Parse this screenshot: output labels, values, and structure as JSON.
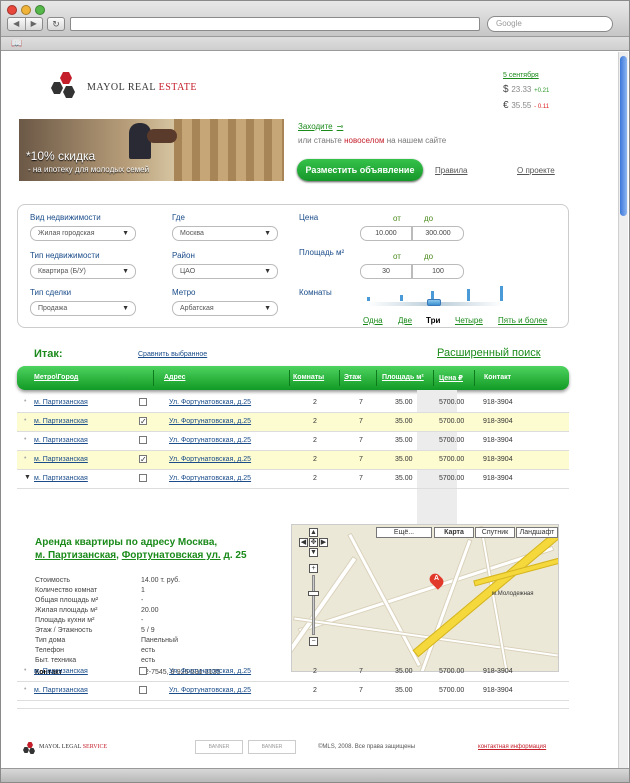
{
  "browser": {
    "search_placeholder": "Google"
  },
  "header": {
    "brand_mayol": "MAYOL",
    "brand_real": "REAL",
    "brand_estate": "ESTATE",
    "date": "5 сентября",
    "usd": {
      "symbol": "$",
      "value": "23.33",
      "change": "+0.21"
    },
    "eur": {
      "symbol": "€",
      "value": "35.55",
      "change": "- 0.11"
    },
    "login": "Заходите",
    "login_arrow": "⊸",
    "register_prefix": "или станьте",
    "register_link": "новоселом",
    "register_suffix": "на нашем сайте",
    "post_button": "Разместить объявление",
    "rules": "Правила",
    "about": "О проекте"
  },
  "banner": {
    "big": "*10% скидка",
    "small": "- на ипотеку для молодых семей"
  },
  "filters": {
    "property_label": "Вид недвижимости",
    "property_value": "Жилая городская",
    "where_label": "Где",
    "where_value": "Москва",
    "ptype_label": "Тип недвижимости",
    "ptype_value": "Квартира (Б/У)",
    "district_label": "Район",
    "district_value": "ЦАО",
    "deal_label": "Тип сделки",
    "deal_value": "Продажа",
    "metro_label": "Метро",
    "metro_value": "Арбатская",
    "price_label": "Цена",
    "from": "от",
    "to": "до",
    "price_from": "10.000",
    "price_to": "300.000",
    "area_label": "Площадь м²",
    "area_from": "30",
    "area_to": "100",
    "rooms_label": "Комнаты",
    "rooms": [
      "Одна",
      "Две",
      "Три",
      "Четыре",
      "Пять и более"
    ],
    "rooms_selected": 2
  },
  "results": {
    "total_label": "Итак:",
    "compare": "Сравнить выбранное",
    "advanced": "Расширенный поиск",
    "columns": [
      "Метро\\Город",
      "Адрес",
      "Комнаты",
      "Этаж",
      "Площадь м²",
      "Цена ₽",
      "Контакт"
    ],
    "rows": [
      {
        "metro": "м. Партизанская",
        "checked": false,
        "address": "Ул. Фортунатовская, д.25",
        "rooms": "2",
        "floor": "7",
        "area": "35.00",
        "price": "5700.00",
        "contact": "918-3904",
        "hl": false
      },
      {
        "metro": "м. Партизанская",
        "checked": true,
        "address": "Ул. Фортунатовская, д.25",
        "rooms": "2",
        "floor": "7",
        "area": "35.00",
        "price": "5700.00",
        "contact": "918-3904",
        "hl": true
      },
      {
        "metro": "м. Партизанская",
        "checked": false,
        "address": "Ул. Фортунатовская, д.25",
        "rooms": "2",
        "floor": "7",
        "area": "35.00",
        "price": "5700.00",
        "contact": "918-3904",
        "hl": false
      },
      {
        "metro": "м. Партизанская",
        "checked": true,
        "address": "Ул. Фортунатовская, д.25",
        "rooms": "2",
        "floor": "7",
        "area": "35.00",
        "price": "5700.00",
        "contact": "918-3904",
        "hl": true
      },
      {
        "metro": "м. Партизанская",
        "checked": false,
        "address": "Ул. Фортунатовская, д.25",
        "rooms": "2",
        "floor": "7",
        "area": "35.00",
        "price": "5700.00",
        "contact": "918-3904",
        "hl": false
      }
    ],
    "rows_after": [
      {
        "metro": "м. Партизанская",
        "checked": false,
        "address": "Ул. Фортунатовская, д.25",
        "rooms": "2",
        "floor": "7",
        "area": "35.00",
        "price": "5700.00",
        "contact": "918-3904"
      },
      {
        "metro": "м. Партизанская",
        "checked": false,
        "address": "Ул. Фортунатовская, д.25",
        "rooms": "2",
        "floor": "7",
        "area": "35.00",
        "price": "5700.00",
        "contact": "918-3904"
      }
    ]
  },
  "detail": {
    "title": "Аренда квартиры по адресу Москва,",
    "metro": "м. Партизанская",
    "comma": ",",
    "street": "Фортунатовская ул.",
    "house": "д. 25",
    "fields": [
      {
        "k": "Стоимость",
        "v": "14.00 т. руб."
      },
      {
        "k": "Количество комнат",
        "v": "1"
      },
      {
        "k": "Общая площадь м²",
        "v": "-"
      },
      {
        "k": "Жилая площадь м²",
        "v": "20.00"
      },
      {
        "k": "Площадь кухни м²",
        "v": "-"
      },
      {
        "k": "Этаж / Этажность",
        "v": "5 / 9"
      },
      {
        "k": "Тип дома",
        "v": "Панельный"
      },
      {
        "k": "Телефон",
        "v": "есть"
      },
      {
        "k": "Быт. техника",
        "v": "есть"
      }
    ],
    "contact_label": "Контакт",
    "contact_value": "92-7545, 8-926-531-3135"
  },
  "map": {
    "more": "Ещё...",
    "map": "Карта",
    "sat": "Спутник",
    "land": "Ландшафт",
    "marker": "A",
    "station": "м.Молодежная",
    "pan": "✥",
    "zoom_in": "+",
    "zoom_out": "−"
  },
  "footer": {
    "brand_mayol": "MAYOL",
    "brand_legal": "LEGAL",
    "brand_service": "SERVICE",
    "banner": "BANNER",
    "copyright": "©MLS, 2008. Все права защищены",
    "contact": "контактная информация"
  },
  "icons": {
    "back": "◀",
    "forward": "▶",
    "reload": "↻",
    "bookmarks": "📖",
    "expand": "▼",
    "arrow_down": "▼",
    "check": "✓",
    "bullet": "•"
  },
  "colors": {
    "brand_green": "#1a8a1a",
    "brand_red": "#c41e2a",
    "link_blue": "#1a4c8a"
  }
}
